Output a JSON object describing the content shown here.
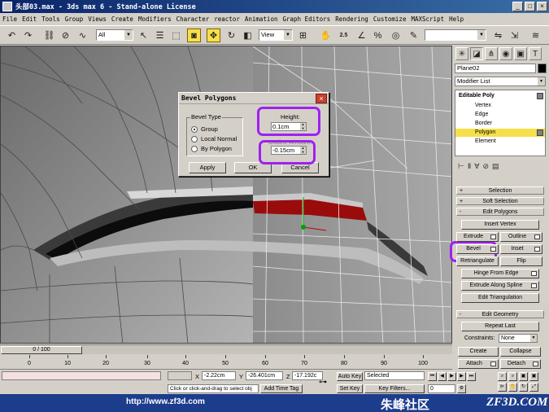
{
  "window": {
    "title": "头部03.max - 3ds max 6 - Stand-alone License",
    "buttons": [
      "_",
      "□",
      "×"
    ]
  },
  "menu": [
    "File",
    "Edit",
    "Tools",
    "Group",
    "Views",
    "Create",
    "Modifiers",
    "Character",
    "reactor",
    "Animation",
    "Graph Editors",
    "Rendering",
    "Customize",
    "MAXScript",
    "Help"
  ],
  "toolbar": {
    "selection_filter": "All",
    "coord_system": "View",
    "snap_value": "2.5",
    "named_selection": ""
  },
  "dialog": {
    "title": "Bevel Polygons",
    "bevel_type_label": "Bevel Type",
    "options": [
      "Group",
      "Local Normal",
      "By Polygon"
    ],
    "selected_option": "Group",
    "height_label": "Height:",
    "height_value": "0.1cm",
    "outline_label": "Outline Amount:",
    "outline_value": "-0.15cm",
    "apply_label": "Apply",
    "ok_label": "OK",
    "cancel_label": "Cancel",
    "close_glyph": "×"
  },
  "command_panel": {
    "object_name": "Plane02",
    "object_color": "#000000",
    "modifier_list": "Modifier List",
    "stack": [
      "Editable Poly",
      "Vertex",
      "Edge",
      "Border",
      "Polygon",
      "Element"
    ],
    "selected_subobject": "Polygon",
    "rollouts": {
      "selection": "Selection",
      "soft_selection": "Soft Selection",
      "edit_polygons": "Edit Polygons",
      "edit_geometry": "Edit Geometry"
    },
    "edit_polygons_buttons": {
      "insert_vertex": "Insert Vertex",
      "extrude": "Extrude",
      "outline": "Outline",
      "bevel": "Bevel",
      "inset": "Inset",
      "retriangulate": "Retriangulate",
      "flip": "Flip",
      "hinge_from_edge": "Hinge From Edge",
      "extrude_along_spline": "Extrude Along Spline",
      "edit_triangulation": "Edit Triangulation"
    },
    "edit_geometry": {
      "repeat_last": "Repeat Last",
      "constraints_label": "Constraints:",
      "constraints_value": "None",
      "create": "Create",
      "collapse": "Collapse",
      "attach": "Attach",
      "detach": "Detach"
    }
  },
  "timeline": {
    "frame_display": "0 / 100",
    "ticks": [
      "0",
      "10",
      "20",
      "30",
      "40",
      "50",
      "60",
      "70",
      "80",
      "90",
      "100"
    ]
  },
  "status": {
    "prompt": "Click or click-and-drag to select obj",
    "add_time_tag": "Add Time Tag",
    "x_label": "X",
    "x_value": "-2.22cm",
    "y_label": "Y",
    "y_value": "-26.401cm",
    "z_label": "Z",
    "z_value": "-17.192c",
    "auto_key": "Auto Key",
    "set_key": "Set Key",
    "key_mode_value": "Selected",
    "key_filters": "Key Filters...",
    "frame": "0"
  },
  "watermark": {
    "url": "http://www.zf3d.com",
    "logo": "朱峰社区",
    "site": "ZF3D.COM"
  },
  "colors": {
    "highlight": "#a020f0",
    "selected_polygons": "#9a0c0c",
    "active_tool": "#f6e04a"
  }
}
